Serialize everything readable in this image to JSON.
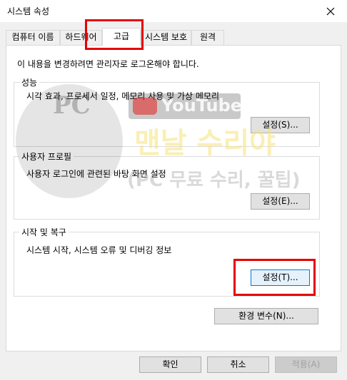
{
  "window": {
    "title": "시스템 속성"
  },
  "tabs": [
    {
      "label": "컴퓨터 이름"
    },
    {
      "label": "하드웨어"
    },
    {
      "label": "고급"
    },
    {
      "label": "시스템 보호"
    },
    {
      "label": "원격"
    }
  ],
  "admin_note": "이 내용을 변경하려면 관리자로 로그온해야 합니다.",
  "performance": {
    "title": "성능",
    "description": "시각 효과, 프로세서 일정, 메모리 사용 및 가상 메모리",
    "button": "설정(S)..."
  },
  "user_profiles": {
    "title": "사용자 프로필",
    "description": "사용자 로그인에 관련된 바탕 화면 설정",
    "button": "설정(E)..."
  },
  "startup_recovery": {
    "title": "시작 및 복구",
    "description": "시스템 시작, 시스템 오류 및 디버깅 정보",
    "button": "설정(T)..."
  },
  "env_button": "환경 변수(N)...",
  "footer": {
    "ok": "확인",
    "cancel": "취소",
    "apply": "적용(A)"
  },
  "watermark": {
    "pc": "PC",
    "youtube": "YouTube",
    "line1": "맨날 수리야",
    "line2": "(PC 무료 수리, 꿀팁)"
  },
  "colors": {
    "highlight": "#e60000",
    "focus": "#0078d7"
  }
}
